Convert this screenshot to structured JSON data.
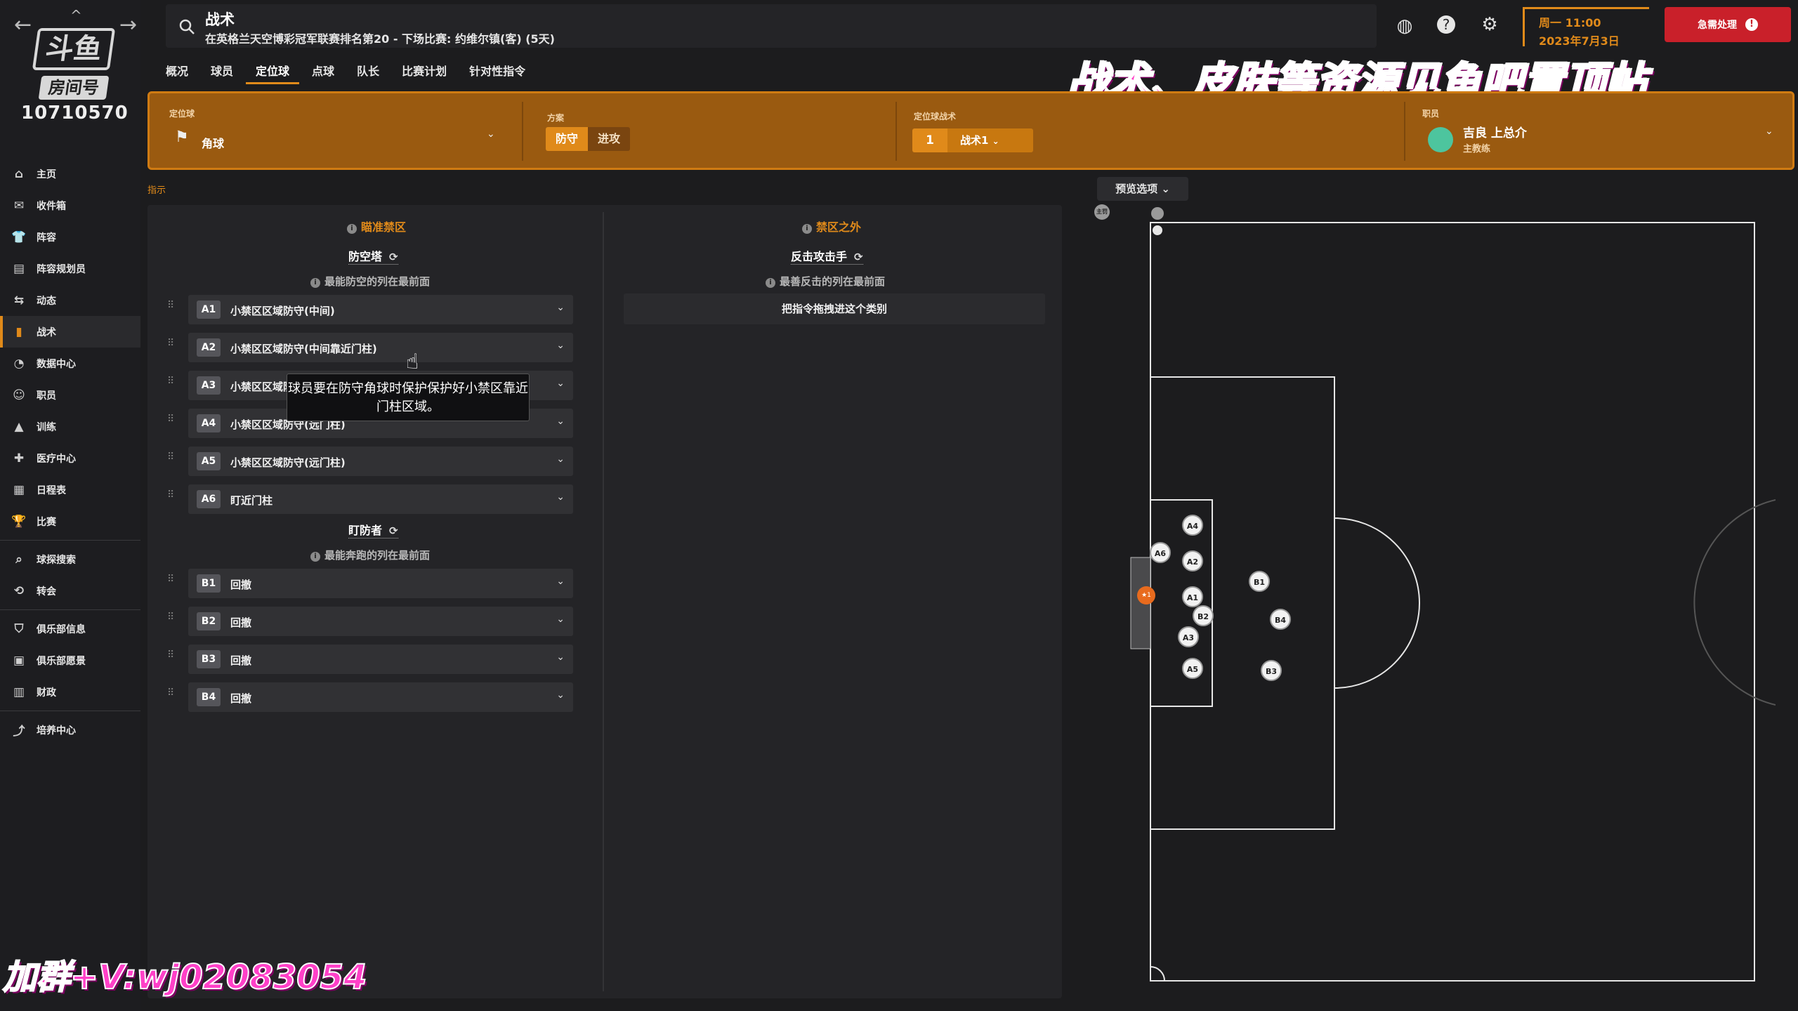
{
  "window": {
    "title": "战术",
    "subtitle": "在英格兰天空博彩冠军联赛排名第20 - 下场比赛: 约维尔镇(客) (5天)"
  },
  "logo": {
    "brand": "斗鱼",
    "room_label": "房间号",
    "room_number": "10710570"
  },
  "datetime": {
    "day": "周一 11:00",
    "date": "2023年7月3日"
  },
  "urgent_button": {
    "label": "急需处理",
    "icon": "exclamation-icon"
  },
  "banner_text": "战术、皮肤等资源见鱼吧置顶帖",
  "bottom_watermark": "加群+V:wj02083054",
  "sidebar": {
    "items": [
      {
        "label": "主页",
        "icon": "home-icon"
      },
      {
        "label": "收件箱",
        "icon": "inbox-icon"
      },
      {
        "label": "阵容",
        "icon": "shirt-icon"
      },
      {
        "label": "阵容规划员",
        "icon": "clipboard-icon"
      },
      {
        "label": "动态",
        "icon": "dynamics-icon"
      },
      {
        "label": "战术",
        "icon": "tactics-icon",
        "active": true
      },
      {
        "label": "数据中心",
        "icon": "data-icon"
      },
      {
        "label": "职员",
        "icon": "staff-icon"
      },
      {
        "label": "训练",
        "icon": "training-icon"
      },
      {
        "label": "医疗中心",
        "icon": "medical-icon"
      },
      {
        "label": "日程表",
        "icon": "calendar-icon"
      },
      {
        "label": "比赛",
        "icon": "trophy-icon"
      },
      {
        "label": "球探搜索",
        "icon": "search-icon"
      },
      {
        "label": "转会",
        "icon": "transfer-icon"
      },
      {
        "label": "俱乐部信息",
        "icon": "shield-icon"
      },
      {
        "label": "俱乐部愿景",
        "icon": "vision-icon"
      },
      {
        "label": "财政",
        "icon": "finance-icon"
      },
      {
        "label": "培养中心",
        "icon": "development-icon"
      }
    ]
  },
  "tabs": [
    {
      "label": "概况"
    },
    {
      "label": "球员"
    },
    {
      "label": "定位球",
      "active": true
    },
    {
      "label": "点球"
    },
    {
      "label": "队长"
    },
    {
      "label": "比赛计划"
    },
    {
      "label": "针对性指令"
    }
  ],
  "controls": {
    "set_piece_label": "定位球",
    "set_piece_value": "角球",
    "scheme_label": "方案",
    "scheme_options": [
      "防守",
      "进攻"
    ],
    "scheme_selected": "防守",
    "routine_label": "定位球战术",
    "routine_number": "1",
    "routine_name": "战术1",
    "staff_label": "职员",
    "staff_name": "吉良 上总介",
    "staff_role": "主教练"
  },
  "hint": "指示",
  "left_column": {
    "heading": "瞄准禁区",
    "group1_title": "防空塔",
    "group1_note": "最能防空的列在最前面",
    "group1_rows": [
      {
        "badge": "A1",
        "text": "小禁区区域防守(中间)"
      },
      {
        "badge": "A2",
        "text": "小禁区区域防守(中间靠近门柱)"
      },
      {
        "badge": "A3",
        "text": "小禁区区域防守(近门柱)"
      },
      {
        "badge": "A4",
        "text": "小禁区区域防守(远门柱)"
      },
      {
        "badge": "A5",
        "text": "小禁区区域防守(远门柱)"
      },
      {
        "badge": "A6",
        "text": "盯近门柱"
      }
    ],
    "group2_title": "盯防者",
    "group2_note": "最能奔跑的列在最前面",
    "group2_rows": [
      {
        "badge": "B1",
        "text": "回撤"
      },
      {
        "badge": "B2",
        "text": "回撤"
      },
      {
        "badge": "B3",
        "text": "回撤"
      },
      {
        "badge": "B4",
        "text": "回撤"
      }
    ]
  },
  "right_column": {
    "heading": "禁区之外",
    "group_title": "反击攻击手",
    "group_note": "最善反击的列在最前面",
    "drop_text": "把指令拖拽进这个类别"
  },
  "tooltip": "球员要在防守角球时保护保护好小禁区靠近门柱区域。",
  "preview_button": "预览选项",
  "pitch": {
    "taker_label": "主罚",
    "tokens": [
      "A1",
      "A2",
      "A3",
      "A4",
      "A5",
      "A6",
      "B1",
      "B2",
      "B3",
      "B4"
    ]
  }
}
